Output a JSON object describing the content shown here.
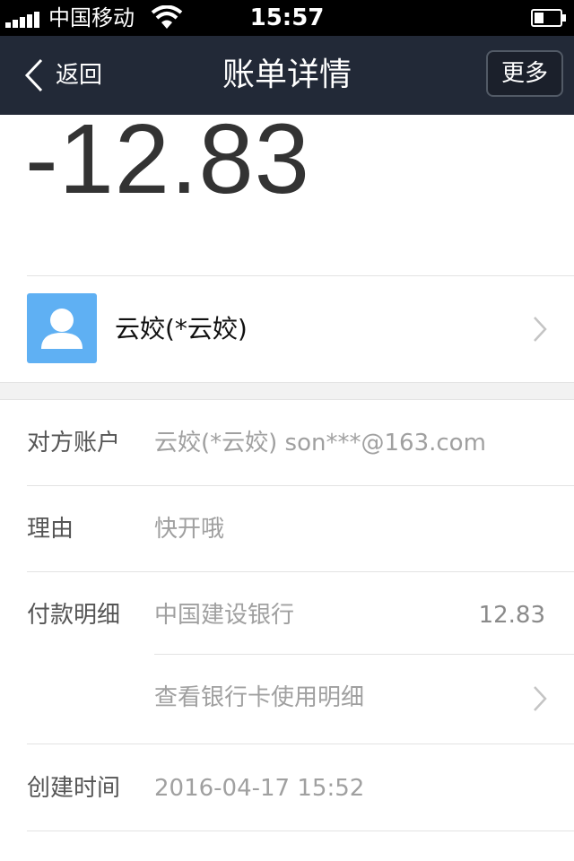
{
  "status_bar": {
    "carrier": "中国移动",
    "time": "15:57"
  },
  "nav": {
    "back_label": "返回",
    "title": "账单详情",
    "more_label": "更多"
  },
  "amount": "-12.83",
  "contact": {
    "name": "云姣(*云姣)",
    "avatar_color": "#5fb0f3"
  },
  "details": {
    "account": {
      "label": "对方账户",
      "value": "云姣(*云姣) son***@163.com"
    },
    "reason": {
      "label": "理由",
      "value": "快开哦"
    },
    "payment": {
      "label": "付款明细",
      "bank": "中国建设银行",
      "amount": "12.83",
      "card_detail_link": "查看银行卡使用明细"
    },
    "created": {
      "label": "创建时间",
      "value": "2016-04-17 15:52"
    }
  },
  "colors": {
    "nav_background": "#222937",
    "status_background": "#000000",
    "avatar": "#5fb0f3"
  }
}
